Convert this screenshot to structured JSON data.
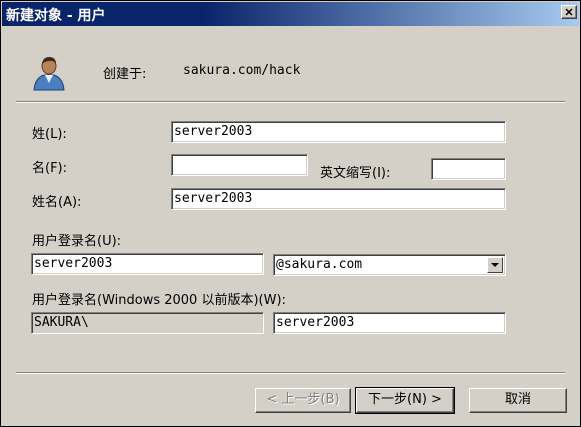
{
  "window": {
    "title": "新建对象 - 用户",
    "close_label": "✕"
  },
  "header": {
    "created_in_label": "创建于:",
    "created_in_path": "sakura.com/hack",
    "icon": "user-icon"
  },
  "form": {
    "last_name_label": "姓(L):",
    "last_name_value": "server2003",
    "first_name_label": "名(F):",
    "first_name_value": "",
    "initials_label": "英文缩写(I):",
    "initials_value": "",
    "full_name_label": "姓名(A):",
    "full_name_value": "server2003",
    "logon_name_label": "用户登录名(U):",
    "logon_name_value": "server2003",
    "upn_suffix_value": "@sakura.com",
    "pre2000_label": "用户登录名(Windows 2000 以前版本)(W):",
    "pre2000_domain_value": "SAKURA\\",
    "pre2000_name_value": "server2003"
  },
  "buttons": {
    "back": "< 上一步(B)",
    "next": "下一步(N) >",
    "cancel": "取消"
  }
}
